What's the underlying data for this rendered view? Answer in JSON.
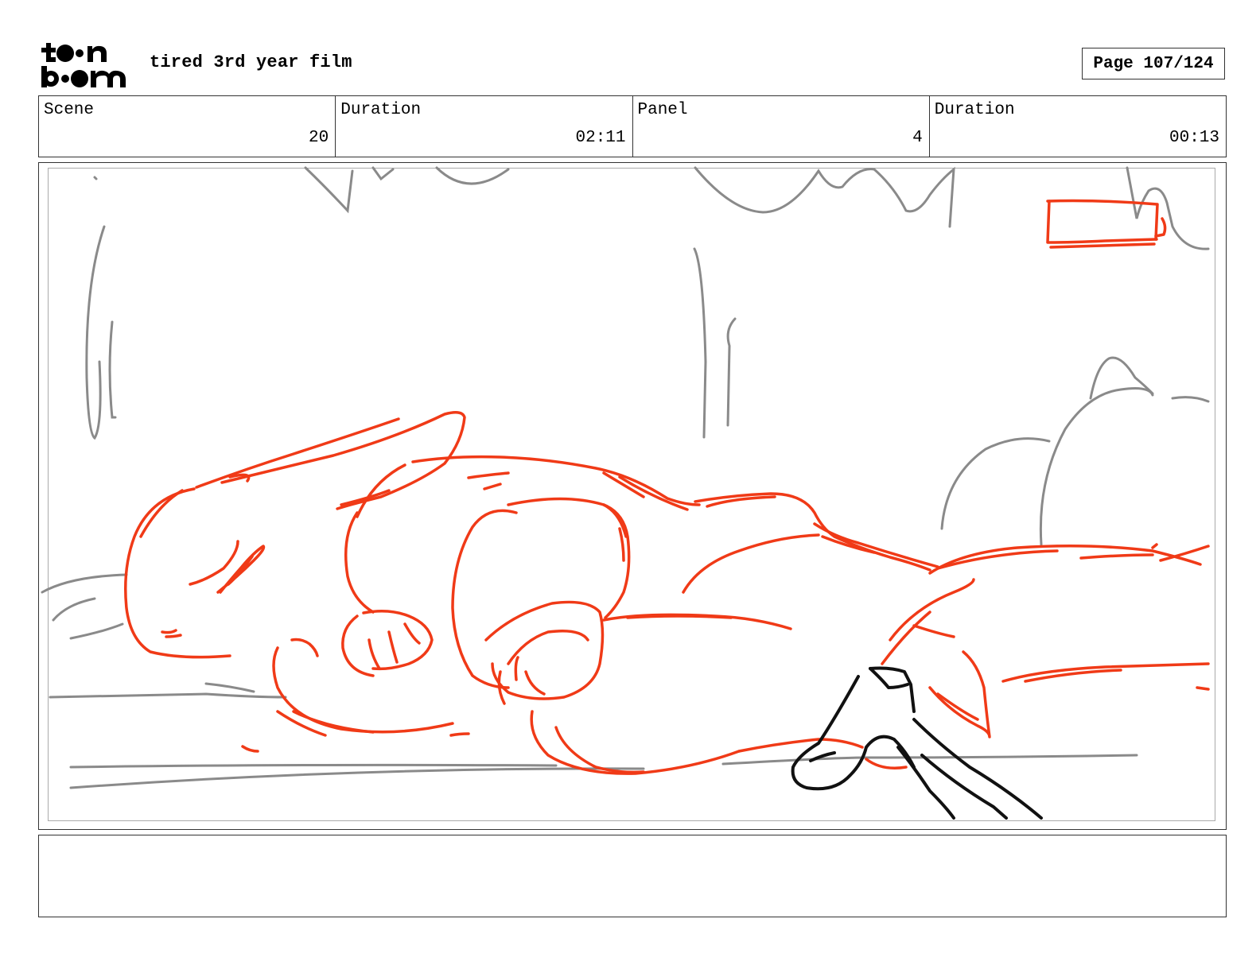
{
  "header": {
    "logo": {
      "line1": "toon",
      "line2": "boom",
      "icon": "toon-boom-logo"
    },
    "project_title": "tired 3rd year film",
    "page_label": "Page 107/124"
  },
  "info": {
    "scene_label": "Scene",
    "scene_value": "20",
    "scene_duration_label": "Duration",
    "scene_duration_value": "02:11",
    "panel_label": "Panel",
    "panel_value": "4",
    "panel_duration_label": "Duration",
    "panel_duration_value": "00:13"
  },
  "panel": {
    "image": "storyboard-sketch-sleeping-rabbit",
    "colors": {
      "character": "#f03a17",
      "background": "#8a8a8a",
      "foreground": "#111111"
    }
  },
  "notes": {
    "text": ""
  }
}
